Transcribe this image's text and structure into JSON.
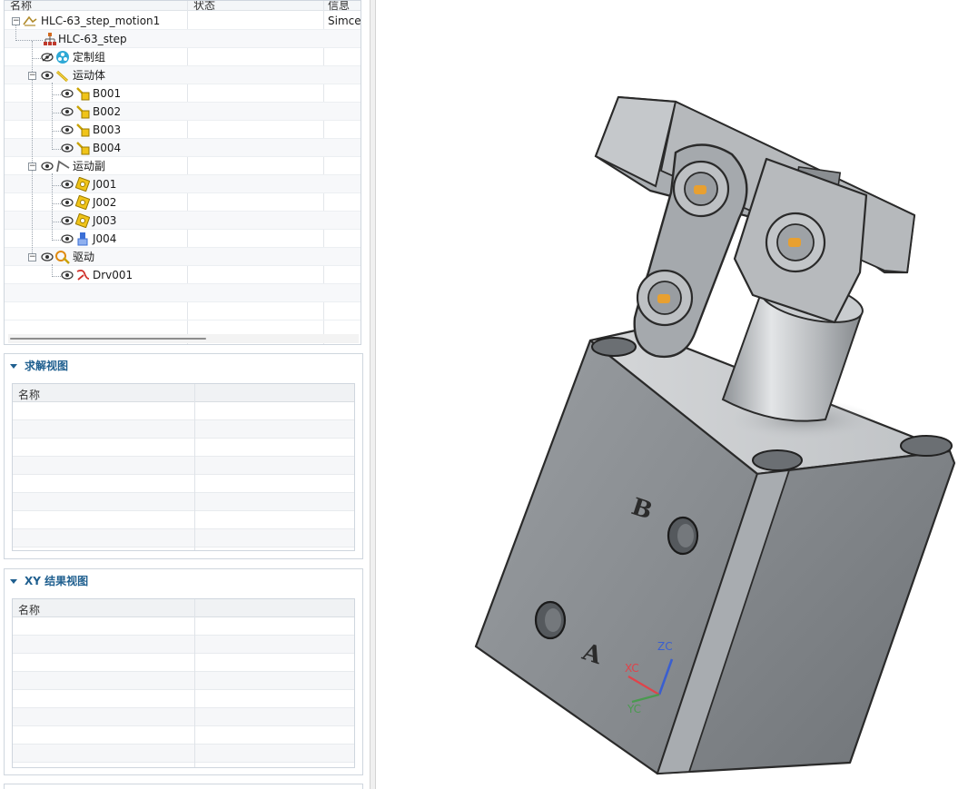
{
  "navigator": {
    "columns": [
      "名称",
      "状态",
      "信息"
    ],
    "rows": [
      {
        "label": "HLC-63_step_motion1",
        "info": "Simcen"
      },
      {
        "label": "HLC-63_step",
        "info": ""
      },
      {
        "label": "定制组",
        "info": ""
      },
      {
        "label": "运动体",
        "info": ""
      },
      {
        "label": "B001",
        "info": ""
      },
      {
        "label": "B002",
        "info": ""
      },
      {
        "label": "B003",
        "info": ""
      },
      {
        "label": "B004",
        "info": ""
      },
      {
        "label": "运动副",
        "info": ""
      },
      {
        "label": "J001",
        "info": ""
      },
      {
        "label": "J002",
        "info": ""
      },
      {
        "label": "J003",
        "info": ""
      },
      {
        "label": "J004",
        "info": ""
      },
      {
        "label": "驱动",
        "info": ""
      },
      {
        "label": "Drv001",
        "info": ""
      }
    ],
    "icons": [
      "motion-sim-icon",
      "assembly-icon",
      "custom-group-icon",
      "link-icon",
      "body-icon",
      "joint-icon",
      "driver-icon",
      "eye-icon"
    ]
  },
  "solve_view": {
    "title": "求解视图",
    "column": "名称"
  },
  "xy_view": {
    "title": "XY 结果视图",
    "column": "名称"
  },
  "viewport": {
    "part_marks": {
      "a": "A",
      "b": "B"
    },
    "triad": {
      "x": "XC",
      "y": "YC",
      "z": "ZC"
    },
    "colors": {
      "xc": "#e0434a",
      "yc": "#4a9a50",
      "zc": "#3a5fd0",
      "body": "#8c9095",
      "pin": "#e8a030"
    }
  }
}
